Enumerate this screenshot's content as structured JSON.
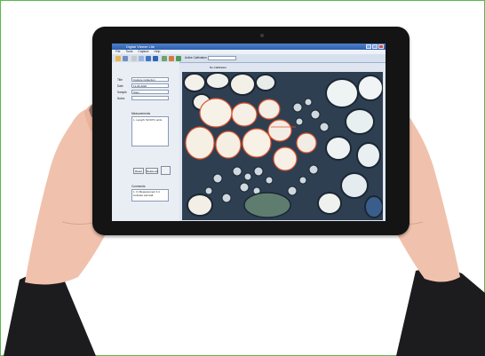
{
  "app": {
    "title": "Digital Viewer Lite",
    "menu": [
      "File",
      "Tools",
      "Capture",
      "Help"
    ],
    "toolbar": {
      "calibration_label": "Active Calibration",
      "calibration_value": "No Calibration"
    }
  },
  "panel": {
    "fields": [
      {
        "label": "Title",
        "value": "Capture Collection"
      },
      {
        "label": "Date",
        "value": "11-06-2020"
      },
      {
        "label": "Sample",
        "value": "Stem"
      },
      {
        "label": "Notes",
        "value": ""
      }
    ],
    "measurements_label": "Measurements",
    "measurements": [
      "1. Length: 52.6371 units"
    ],
    "buttons": {
      "reset": "Reset",
      "delete_all": "Delete all"
    },
    "comments_label": "Comments",
    "comments_text": "1. In Measurement 1 it includes cell wall"
  },
  "colors": {
    "frame_border": "#57b84f",
    "title_bar": "#2d5fae",
    "measurement_outline": "#e0532e"
  }
}
